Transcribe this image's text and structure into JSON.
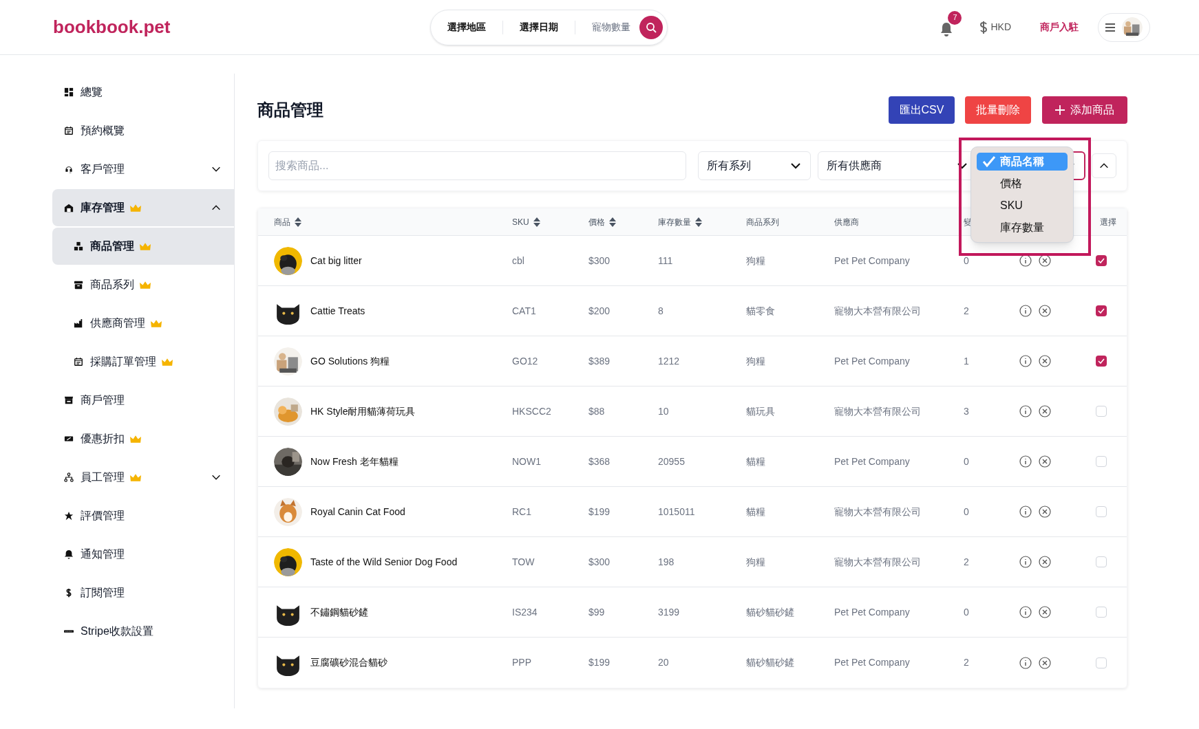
{
  "header": {
    "logo": "bookbook.pet",
    "search": {
      "segments": [
        "選擇地區",
        "選擇日期"
      ],
      "placeholder": "寵物數量"
    },
    "notifications": "7",
    "currency": "HKD",
    "merchant_link": "商戶入駐"
  },
  "sidebar": {
    "items": [
      {
        "label": "總覽",
        "premium": false
      },
      {
        "label": "預約概覽",
        "premium": false
      },
      {
        "label": "客戶管理",
        "premium": false,
        "expanded": false
      },
      {
        "label": "庫存管理",
        "premium": true,
        "expanded": true,
        "children": [
          {
            "label": "商品管理",
            "premium": true,
            "selected": true
          },
          {
            "label": "商品系列",
            "premium": true,
            "selected": false
          },
          {
            "label": "供應商管理",
            "premium": true,
            "selected": false
          },
          {
            "label": "採購訂單管理",
            "premium": true,
            "selected": false
          }
        ]
      },
      {
        "label": "商戶管理",
        "premium": false
      },
      {
        "label": "優惠折扣",
        "premium": true
      },
      {
        "label": "員工管理",
        "premium": true,
        "expanded": false
      },
      {
        "label": "評價管理",
        "premium": false
      },
      {
        "label": "通知管理",
        "premium": false
      },
      {
        "label": "訂閱管理",
        "premium": false
      },
      {
        "label": "Stripe收款設置",
        "premium": false
      }
    ]
  },
  "page": {
    "title": "商品管理",
    "buttons": [
      {
        "label": "匯出CSV",
        "kind": "export"
      },
      {
        "label": "批量刪除",
        "kind": "delete"
      },
      {
        "label": "添加商品",
        "kind": "add"
      }
    ]
  },
  "filters": {
    "search_placeholder": "搜索商品...",
    "series": "所有系列",
    "supplier": "所有供應商",
    "sort_menu": [
      {
        "label": "商品名稱",
        "selected": true
      },
      {
        "label": "價格",
        "selected": false
      },
      {
        "label": "SKU",
        "selected": false
      },
      {
        "label": "庫存數量",
        "selected": false
      }
    ]
  },
  "table": {
    "columns": [
      {
        "label": "商品",
        "sortable": true
      },
      {
        "label": "SKU",
        "sortable": true
      },
      {
        "label": "價格",
        "sortable": true
      },
      {
        "label": "庫存數量",
        "sortable": true
      },
      {
        "label": "商品系列",
        "sortable": false
      },
      {
        "label": "供應商",
        "sortable": false
      },
      {
        "label": "變",
        "sortable": false
      },
      {
        "label": "選擇",
        "sortable": false
      }
    ],
    "rows": [
      {
        "name": "Cat big litter",
        "sku": "cbl",
        "price": "$300",
        "stock": "111",
        "series": "狗糧",
        "supplier": "Pet Pet Company",
        "variants": "0",
        "checked": true
      },
      {
        "name": "Cattie Treats",
        "sku": "CAT1",
        "price": "$200",
        "stock": "8",
        "series": "貓零食",
        "supplier": "寵物大本營有限公司",
        "variants": "2",
        "checked": true
      },
      {
        "name": "GO Solutions 狗糧",
        "sku": "GO12",
        "price": "$389",
        "stock": "1212",
        "series": "狗糧",
        "supplier": "Pet Pet Company",
        "variants": "1",
        "checked": true
      },
      {
        "name": "HK Style耐用貓薄荷玩具",
        "sku": "HKSCC2",
        "price": "$88",
        "stock": "10",
        "series": "貓玩具",
        "supplier": "寵物大本營有限公司",
        "variants": "3",
        "checked": false
      },
      {
        "name": "Now Fresh 老年貓糧",
        "sku": "NOW1",
        "price": "$368",
        "stock": "20955",
        "series": "貓糧",
        "supplier": "Pet Pet Company",
        "variants": "0",
        "checked": false
      },
      {
        "name": "Royal Canin Cat Food",
        "sku": "RC1",
        "price": "$199",
        "stock": "1015011",
        "series": "貓糧",
        "supplier": "寵物大本營有限公司",
        "variants": "0",
        "checked": false
      },
      {
        "name": "Taste of the Wild Senior Dog Food",
        "sku": "TOW",
        "price": "$300",
        "stock": "198",
        "series": "狗糧",
        "supplier": "寵物大本營有限公司",
        "variants": "2",
        "checked": false
      },
      {
        "name": "不鏽鋼貓砂鏟",
        "sku": "IS234",
        "price": "$99",
        "stock": "3199",
        "series": "貓砂貓砂鏟",
        "supplier": "Pet Pet Company",
        "variants": "0",
        "checked": false
      },
      {
        "name": "豆腐礦砂混合貓砂",
        "sku": "PPP",
        "price": "$199",
        "stock": "20",
        "series": "貓砂貓砂鏟",
        "supplier": "Pet Pet Company",
        "variants": "2",
        "checked": false
      }
    ]
  }
}
